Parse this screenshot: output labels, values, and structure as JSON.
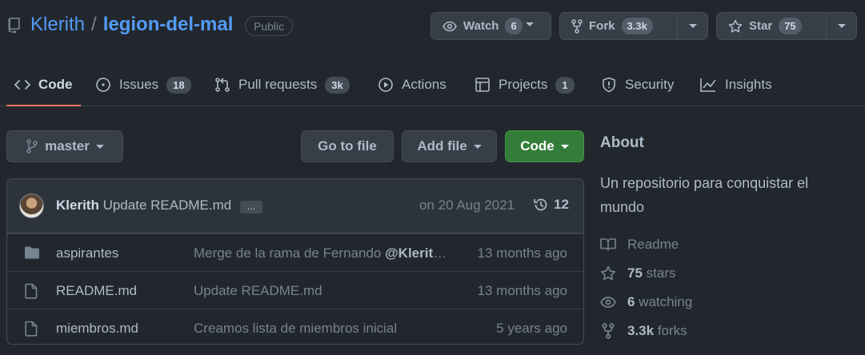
{
  "repo": {
    "owner": "Klerith",
    "separator": "/",
    "name": "legion-del-mal",
    "visibility": "Public"
  },
  "actions": {
    "watch": {
      "label": "Watch",
      "count": "6"
    },
    "fork": {
      "label": "Fork",
      "count": "3.3k"
    },
    "star": {
      "label": "Star",
      "count": "75"
    }
  },
  "tabs": [
    {
      "label": "Code",
      "icon": "code-icon",
      "active": true
    },
    {
      "label": "Issues",
      "icon": "issue-icon",
      "count": "18"
    },
    {
      "label": "Pull requests",
      "icon": "pull-request-icon",
      "count": "3k"
    },
    {
      "label": "Actions",
      "icon": "play-icon"
    },
    {
      "label": "Projects",
      "icon": "project-table-icon",
      "count": "1"
    },
    {
      "label": "Security",
      "icon": "shield-icon"
    },
    {
      "label": "Insights",
      "icon": "graph-icon"
    }
  ],
  "toolbar": {
    "branch": "master",
    "go_to_file": "Go to file",
    "add_file": "Add file",
    "code": "Code"
  },
  "latest_commit": {
    "author": "Klerith",
    "message": "Update README.md",
    "ellipsis": "…",
    "date": "on 20 Aug 2021",
    "commit_count": "12"
  },
  "files": [
    {
      "type": "folder",
      "name": "aspirantes",
      "message": "Merge de la rama de Fernando ",
      "mention": "@Klerith/...",
      "age": "13 months ago"
    },
    {
      "type": "file",
      "name": "README.md",
      "message": "Update README.md",
      "mention": "",
      "age": "13 months ago"
    },
    {
      "type": "file",
      "name": "miembros.md",
      "message": "Creamos lista de miembros inicial",
      "mention": "",
      "age": "5 years ago"
    }
  ],
  "about": {
    "heading": "About",
    "description": "Un repositorio para conquistar el mundo",
    "readme": "Readme",
    "stars_count": "75",
    "stars_label": "stars",
    "watching_count": "6",
    "watching_label": "watching",
    "forks_count": "3.3k",
    "forks_label": "forks"
  },
  "colors": {
    "background": "#22272e",
    "link": "#539bf5",
    "active_tab_underline": "#ec775c",
    "code_button": "#347d39"
  }
}
